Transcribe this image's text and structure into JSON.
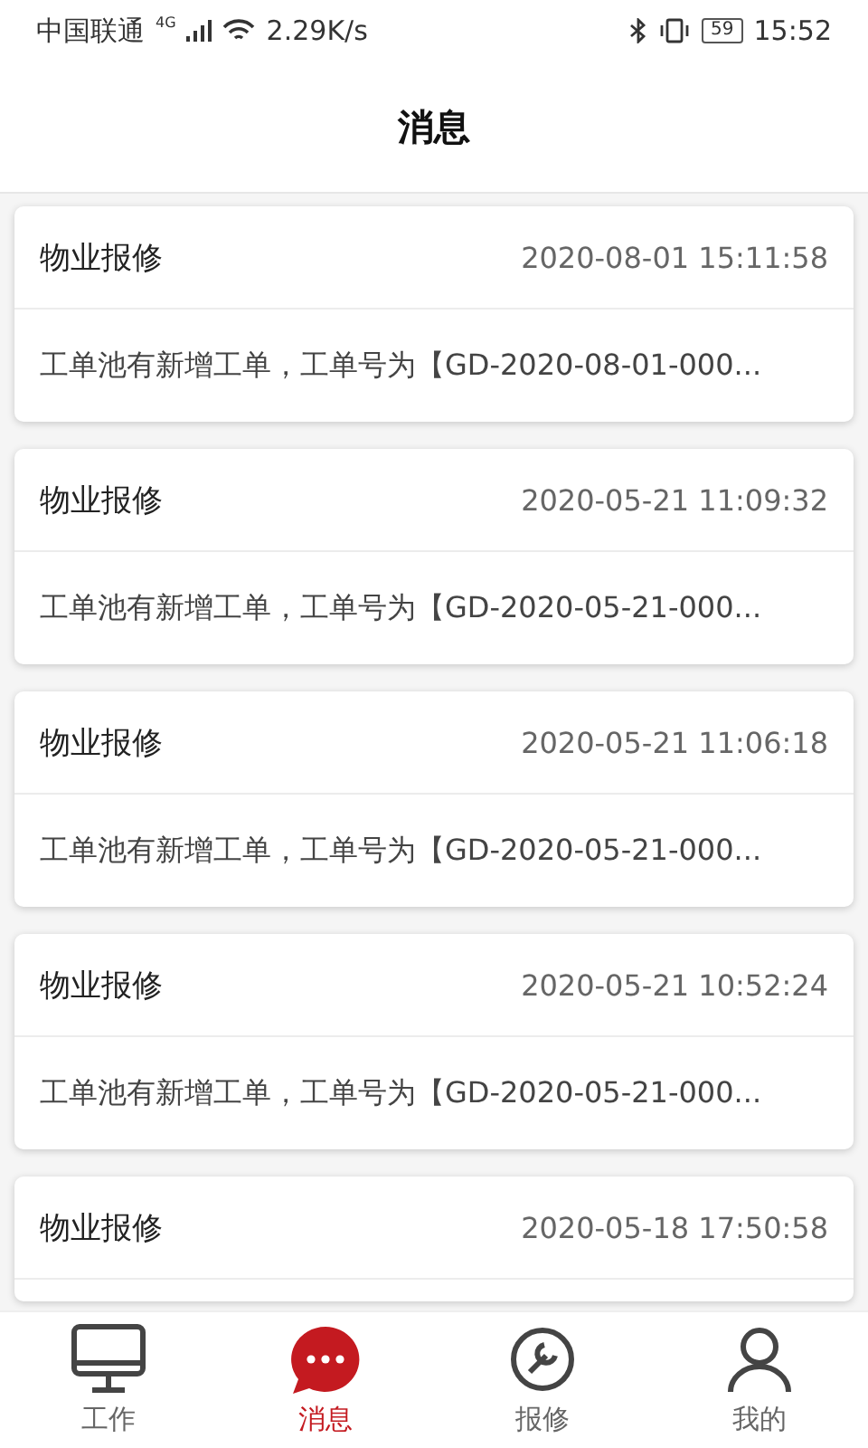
{
  "status_bar": {
    "carrier": "中国联通",
    "network": "4G",
    "speed": "2.29K/s",
    "battery": "59",
    "time": "15:52"
  },
  "header": {
    "title": "消息"
  },
  "messages": [
    {
      "title": "物业报修",
      "time": "2020-08-01 15:11:58",
      "body": "工单池有新增工单，工单号为【GD-2020-08-01-000..."
    },
    {
      "title": "物业报修",
      "time": "2020-05-21 11:09:32",
      "body": "工单池有新增工单，工单号为【GD-2020-05-21-000..."
    },
    {
      "title": "物业报修",
      "time": "2020-05-21 11:06:18",
      "body": "工单池有新增工单，工单号为【GD-2020-05-21-000..."
    },
    {
      "title": "物业报修",
      "time": "2020-05-21 10:52:24",
      "body": "工单池有新增工单，工单号为【GD-2020-05-21-000..."
    },
    {
      "title": "物业报修",
      "time": "2020-05-18 17:50:58"
    }
  ],
  "tab_bar": [
    {
      "kind": "work",
      "label": "工作",
      "selected": false
    },
    {
      "kind": "messages",
      "label": "消息",
      "selected": true
    },
    {
      "kind": "repair",
      "label": "报修",
      "selected": false
    },
    {
      "kind": "profile",
      "label": "我的",
      "selected": false
    }
  ]
}
